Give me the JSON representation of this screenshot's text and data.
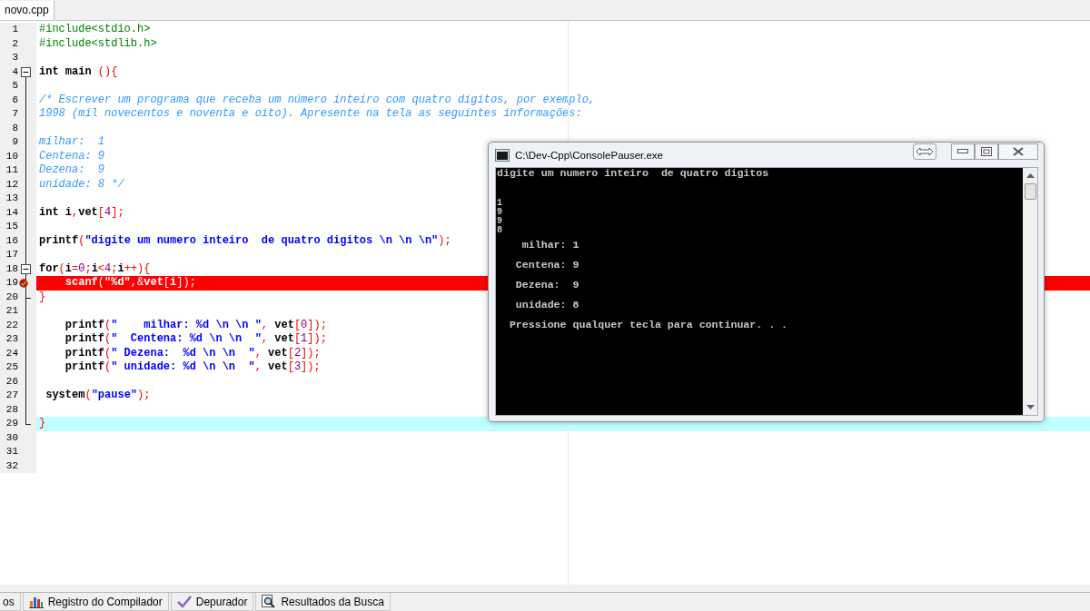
{
  "file_tabs": [
    {
      "label": "novo.cpp",
      "selected": true
    }
  ],
  "lines": [
    {
      "number": "1",
      "segments": [
        {
          "kind": "preproc",
          "text": "#include<stdio.h>"
        }
      ]
    },
    {
      "number": "2",
      "segments": [
        {
          "kind": "preproc",
          "text": "#include<stdlib.h>"
        }
      ]
    },
    {
      "number": "3"
    },
    {
      "number": "4",
      "expanded": true,
      "segments": [
        {
          "kind": "keyword",
          "text": "int"
        },
        {
          "kind": "plain",
          "text": " main "
        },
        {
          "kind": "symbol",
          "text": "(){"
        }
      ],
      "children": [
        {
          "number": "5"
        },
        {
          "number": "6",
          "segments": [
            {
              "kind": "comment",
              "text": "/* Escrever um programa que receba um número inteiro com quatro dígitos, por exemplo,"
            }
          ]
        },
        {
          "number": "7",
          "segments": [
            {
              "kind": "comment",
              "text": "1998 (mil novecentos e noventa e oito). Apresente na tela as seguintes informações:"
            }
          ]
        },
        {
          "number": "8"
        },
        {
          "number": "9",
          "segments": [
            {
              "kind": "comment",
              "text": "milhar:  1"
            }
          ]
        },
        {
          "number": "10",
          "segments": [
            {
              "kind": "comment",
              "text": "Centena: 9"
            }
          ]
        },
        {
          "number": "11",
          "segments": [
            {
              "kind": "comment",
              "text": "Dezena:  9"
            }
          ]
        },
        {
          "number": "12",
          "segments": [
            {
              "kind": "comment",
              "text": "unidade: 8 */"
            }
          ]
        },
        {
          "number": "13"
        },
        {
          "number": "14",
          "segments": [
            {
              "kind": "keyword",
              "text": "int"
            },
            {
              "kind": "plain",
              "text": " i"
            },
            {
              "kind": "symbol",
              "text": ","
            },
            {
              "kind": "plain",
              "text": "vet"
            },
            {
              "kind": "symbol",
              "text": "["
            },
            {
              "kind": "number",
              "text": "4"
            },
            {
              "kind": "symbol",
              "text": "];"
            }
          ]
        },
        {
          "number": "15"
        },
        {
          "number": "16",
          "segments": [
            {
              "kind": "plain",
              "text": "printf"
            },
            {
              "kind": "symbol",
              "text": "("
            },
            {
              "kind": "string",
              "text": "\"digite um numero inteiro  de quatro digitos \\n \\n \\n\""
            },
            {
              "kind": "symbol",
              "text": ");"
            }
          ]
        },
        {
          "number": "17"
        },
        {
          "number": "18",
          "expanded": true,
          "segments": [
            {
              "kind": "keyword",
              "text": "for"
            },
            {
              "kind": "symbol",
              "text": "("
            },
            {
              "kind": "plain",
              "text": "i"
            },
            {
              "kind": "symbol",
              "text": "="
            },
            {
              "kind": "number",
              "text": "0"
            },
            {
              "kind": "symbol",
              "text": ";"
            },
            {
              "kind": "plain",
              "text": "i"
            },
            {
              "kind": "symbol",
              "text": "<"
            },
            {
              "kind": "number",
              "text": "4"
            },
            {
              "kind": "symbol",
              "text": ";"
            },
            {
              "kind": "plain",
              "text": "i"
            },
            {
              "kind": "symbol",
              "text": "++){"
            }
          ],
          "children": [
            {
              "number": "19",
              "breakpoint": true,
              "segments": [
                {
                  "kind": "plain",
                  "text": "    scanf"
                },
                {
                  "kind": "symbol",
                  "text": "("
                },
                {
                  "kind": "string",
                  "text": "\"%d\""
                },
                {
                  "kind": "symbol",
                  "text": ",&"
                },
                {
                  "kind": "plain",
                  "text": "vet"
                },
                {
                  "kind": "symbol",
                  "text": "["
                },
                {
                  "kind": "plain",
                  "text": "i"
                },
                {
                  "kind": "symbol",
                  "text": "]);"
                }
              ]
            },
            {
              "number": "20",
              "segments": [
                {
                  "kind": "symbol",
                  "text": "}"
                }
              ]
            }
          ]
        },
        {
          "number": "21"
        },
        {
          "number": "22",
          "segments": [
            {
              "kind": "plain",
              "text": "    printf"
            },
            {
              "kind": "symbol",
              "text": "("
            },
            {
              "kind": "string",
              "text": "\"    milhar: %d \\n \\n \""
            },
            {
              "kind": "symbol",
              "text": ", "
            },
            {
              "kind": "plain",
              "text": "vet"
            },
            {
              "kind": "symbol",
              "text": "["
            },
            {
              "kind": "number",
              "text": "0"
            },
            {
              "kind": "symbol",
              "text": "]);"
            }
          ]
        },
        {
          "number": "23",
          "segments": [
            {
              "kind": "plain",
              "text": "    printf"
            },
            {
              "kind": "symbol",
              "text": "("
            },
            {
              "kind": "string",
              "text": "\"  Centena: %d \\n \\n  \""
            },
            {
              "kind": "symbol",
              "text": ", "
            },
            {
              "kind": "plain",
              "text": "vet"
            },
            {
              "kind": "symbol",
              "text": "["
            },
            {
              "kind": "number",
              "text": "1"
            },
            {
              "kind": "symbol",
              "text": "]);"
            }
          ]
        },
        {
          "number": "24",
          "segments": [
            {
              "kind": "plain",
              "text": "    printf"
            },
            {
              "kind": "symbol",
              "text": "("
            },
            {
              "kind": "string",
              "text": "\" Dezena:  %d \\n \\n  \""
            },
            {
              "kind": "symbol",
              "text": ", "
            },
            {
              "kind": "plain",
              "text": "vet"
            },
            {
              "kind": "symbol",
              "text": "["
            },
            {
              "kind": "number",
              "text": "2"
            },
            {
              "kind": "symbol",
              "text": "]);"
            }
          ]
        },
        {
          "number": "25",
          "segments": [
            {
              "kind": "plain",
              "text": "    printf"
            },
            {
              "kind": "symbol",
              "text": "("
            },
            {
              "kind": "string",
              "text": "\" unidade: %d \\n \\n  \""
            },
            {
              "kind": "symbol",
              "text": ", "
            },
            {
              "kind": "plain",
              "text": "vet"
            },
            {
              "kind": "symbol",
              "text": "["
            },
            {
              "kind": "number",
              "text": "3"
            },
            {
              "kind": "symbol",
              "text": "]);"
            }
          ]
        },
        {
          "number": "26"
        },
        {
          "number": "27",
          "segments": [
            {
              "kind": "plain",
              "text": " system"
            },
            {
              "kind": "symbol",
              "text": "("
            },
            {
              "kind": "string",
              "text": "\"pause\""
            },
            {
              "kind": "symbol",
              "text": ");"
            }
          ]
        },
        {
          "number": "28"
        },
        {
          "number": "29",
          "current": true,
          "segments": [
            {
              "kind": "symbol",
              "text": "}"
            }
          ]
        }
      ]
    },
    {
      "number": "30"
    },
    {
      "number": "31"
    },
    {
      "number": "32"
    }
  ],
  "console_window": {
    "title": "C:\\Dev-Cpp\\ConsolePauser.exe",
    "output": [
      {
        "kind": "prompt",
        "text": "digite um numero inteiro  de quatro digitos"
      },
      {
        "kind": "input",
        "text": "1"
      },
      {
        "kind": "input",
        "text": "9"
      },
      {
        "kind": "input",
        "text": "9"
      },
      {
        "kind": "input",
        "text": "8"
      },
      {
        "kind": "result",
        "text": "    milhar: 1"
      },
      {
        "kind": "result",
        "text": "   Centena: 9"
      },
      {
        "kind": "result",
        "text": "   Dezena:  9"
      },
      {
        "kind": "result",
        "text": "   unidade: 8"
      },
      {
        "kind": "result",
        "text": "  Pressione qualquer tecla para continuar. . ."
      }
    ]
  },
  "bottom_tabs": [
    {
      "label": "os",
      "selected": false
    },
    {
      "label": "Registro do Compilador",
      "selected": false
    },
    {
      "label": "Depurador",
      "selected": false
    },
    {
      "label": "Resultados da Busca",
      "selected": false
    }
  ]
}
